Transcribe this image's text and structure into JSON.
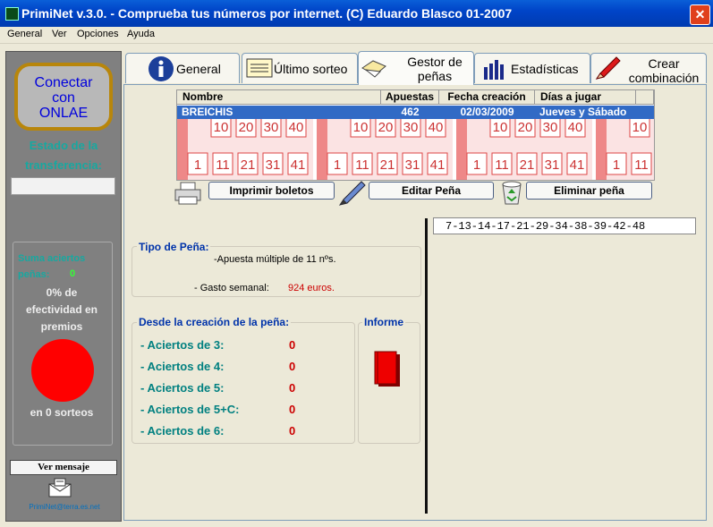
{
  "window": {
    "title": "PrimiNet v.3.0.  - Comprueba tus números por internet. (C) Eduardo Blasco 01-2007",
    "close_label": "✕"
  },
  "menu": [
    "General",
    "Ver",
    "Opciones",
    "Ayuda"
  ],
  "left_panel": {
    "connect_button": [
      "Conectar",
      "con",
      "ONLAE"
    ],
    "estado_label": [
      "Estado de la",
      "transferencia:"
    ],
    "suma_label": [
      "Suma aciertos",
      "peñas:"
    ],
    "suma_value": "0",
    "efectividad": [
      "0% de",
      "efectividad en",
      "premios"
    ],
    "sorteos": "en 0 sorteos",
    "ver_mensaje": "Ver mensaje",
    "email": "PrimiNet@terra.es.net"
  },
  "tabs": [
    {
      "label": "General",
      "icon": "info-icon"
    },
    {
      "label": "Último sorteo",
      "icon": "ticket-icon"
    },
    {
      "label": "Gestor de peñas",
      "icon": "folder-icon",
      "active": true
    },
    {
      "label": "Estadísticas",
      "icon": "bar-chart-icon"
    },
    {
      "label": "Crear combinación",
      "icon": "pencil-icon"
    }
  ],
  "table": {
    "columns": [
      "Nombre",
      "Apuestas",
      "Fecha creación",
      "Días a jugar"
    ],
    "rows": [
      {
        "nombre": "BREICHIS",
        "apuestas": "462",
        "fecha": "02/03/2009",
        "dias": "Jueves y Sábado"
      }
    ],
    "ticket_numbers_top": [
      "10",
      "20",
      "30",
      "40"
    ],
    "ticket_numbers_bottom": [
      "1",
      "11",
      "21",
      "31",
      "41"
    ]
  },
  "buttons": {
    "imprimir": "Imprimir boletos",
    "editar": "Editar Peña",
    "eliminar": "Eliminar peña"
  },
  "result_combination": "7-13-14-17-21-29-34-38-39-42-48",
  "tipo_pena": {
    "title": "Tipo de Peña:",
    "apuesta": "-Apuesta múltiple de 11 nºs.",
    "gasto_label": "- Gasto semanal:",
    "gasto_value": "924 euros."
  },
  "desde": {
    "title": "Desde la creación de la peña:",
    "aciertos": [
      {
        "label": "- Aciertos de 3:",
        "value": "0"
      },
      {
        "label": "- Aciertos de 4:",
        "value": "0"
      },
      {
        "label": "- Aciertos de 5:",
        "value": "0"
      },
      {
        "label": "- Aciertos de 5+C:",
        "value": "0"
      },
      {
        "label": "- Aciertos de 6:",
        "value": "0"
      }
    ]
  },
  "informe": {
    "title": "Informe"
  }
}
